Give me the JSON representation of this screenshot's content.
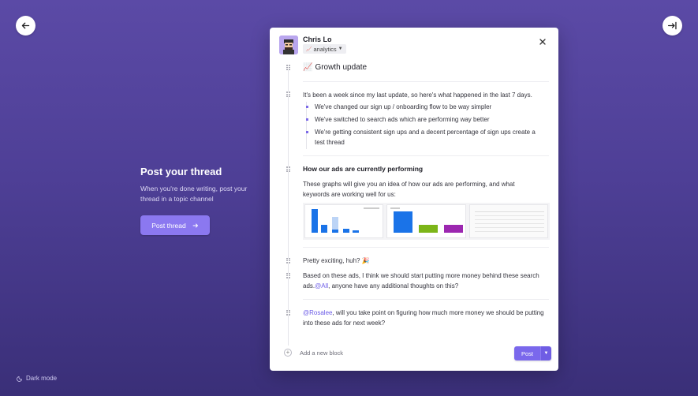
{
  "colors": {
    "accent": "#7a68ec",
    "background_top": "#5b4aa6",
    "background_bottom": "#3a2f78",
    "mention": "#6c5ce7"
  },
  "nav": {
    "back_icon": "arrow-left-icon",
    "collapse_icon": "collapse-right-icon"
  },
  "promo": {
    "title": "Post your thread",
    "description": "When you're done writing, post your thread in a topic channel",
    "button_label": "Post thread"
  },
  "footer": {
    "dark_mode_label": "Dark mode"
  },
  "composer": {
    "author": "Chris Lo",
    "channel": {
      "emoji": "📈",
      "name": "analytics"
    },
    "title_emoji": "📈",
    "title": "Growth update",
    "intro": "It's been a week since my last update, so here's what happened in the last 7 days.",
    "bullets": [
      "We've changed our sign up / onboarding flow to be way simpler",
      "We've switched to search ads which are performing way better",
      "We're getting consistent sign ups and a decent percentage of sign ups create a test thread"
    ],
    "section_heading": "How our ads are currently performing",
    "section_text": "These graphs will give you an idea of how our ads are performing, and what keywords are working well for us:",
    "excited": "Pretty exciting, huh? 🎉",
    "para2_before": "Based on these ads, I think we should start putting more money behind these search ads.",
    "para2_mention": "@All",
    "para2_after": ", anyone have any additional thoughts on this?",
    "para3_mention": "@Rosalee",
    "para3_text": ", will you take point on figuring how much more money we should be putting into these ads for next week?",
    "add_block_label": "Add a new block",
    "post_label": "Post"
  }
}
